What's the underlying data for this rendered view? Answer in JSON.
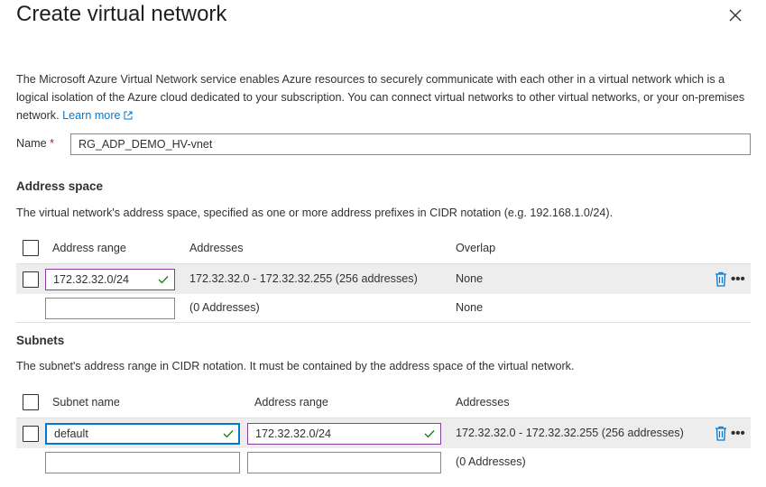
{
  "header": {
    "title": "Create virtual network",
    "close_icon": "close-icon"
  },
  "intro": {
    "text": "The Microsoft Azure Virtual Network service enables Azure resources to securely communicate with each other in a virtual network which is a logical isolation of the Azure cloud dedicated to your subscription. You can connect virtual networks to other virtual networks, or your on-premises network.",
    "learn_more": "Learn more"
  },
  "name_field": {
    "label": "Name",
    "required_mark": "*",
    "value": "RG_ADP_DEMO_HV-vnet"
  },
  "address_space": {
    "heading": "Address space",
    "description": "The virtual network's address space, specified as one or more address prefixes in CIDR notation (e.g. 192.168.1.0/24).",
    "columns": [
      "Address range",
      "Addresses",
      "Overlap"
    ],
    "rows": [
      {
        "address_range": "172.32.32.0/24",
        "addresses": "172.32.32.0 - 172.32.32.255 (256 addresses)",
        "overlap": "None"
      },
      {
        "address_range": "",
        "addresses": "(0 Addresses)",
        "overlap": "None"
      }
    ]
  },
  "subnets": {
    "heading": "Subnets",
    "description": "The subnet's address range in CIDR notation. It must be contained by the address space of the virtual network.",
    "columns": [
      "Subnet name",
      "Address range",
      "Addresses"
    ],
    "rows": [
      {
        "subnet_name": "default",
        "address_range": "172.32.32.0/24",
        "addresses": "172.32.32.0 - 172.32.32.255 (256 addresses)"
      },
      {
        "subnet_name": "",
        "address_range": "",
        "addresses": "(0 Addresses)"
      }
    ]
  },
  "row_actions": {
    "delete_icon": "trash-icon",
    "more_label": "•••"
  },
  "colors": {
    "accent": "#0078d4",
    "valid_border": "#8a3ea0",
    "valid_check": "#107c10",
    "required": "#a4262c",
    "selected_row": "#ededed"
  }
}
